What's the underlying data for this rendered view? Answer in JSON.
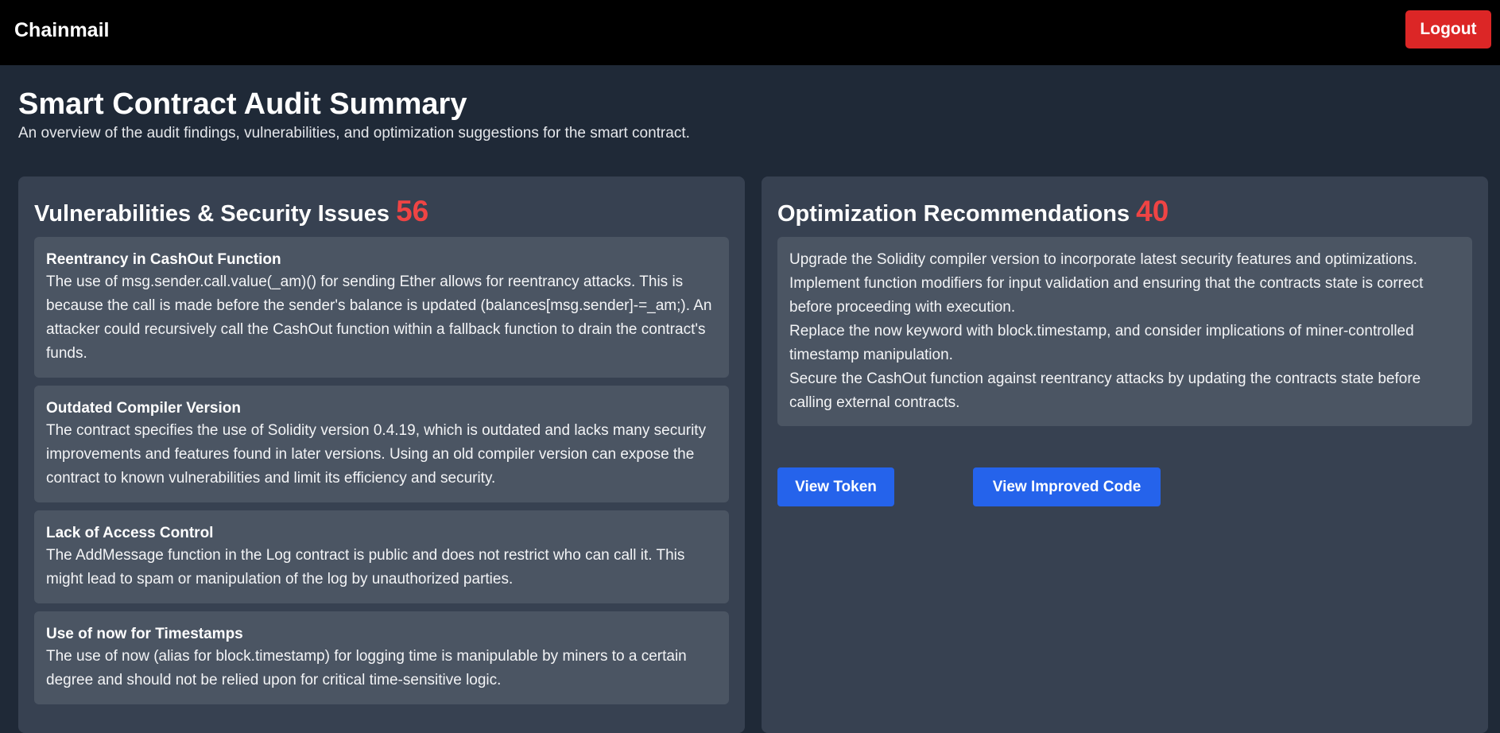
{
  "header": {
    "brand": "Chainmail",
    "logout_label": "Logout"
  },
  "page": {
    "title": "Smart Contract Audit Summary",
    "subtitle": "An overview of the audit findings, vulnerabilities, and optimization suggestions for the smart contract."
  },
  "vulnerabilities": {
    "heading": "Vulnerabilities & Security Issues",
    "count": "56",
    "items": [
      {
        "title": "Reentrancy in CashOut Function",
        "description": "The use of msg.sender.call.value(_am)() for sending Ether allows for reentrancy attacks. This is because the call is made before the sender's balance is updated (balances[msg.sender]-=_am;). An attacker could recursively call the CashOut function within a fallback function to drain the contract's funds."
      },
      {
        "title": "Outdated Compiler Version",
        "description": "The contract specifies the use of Solidity version 0.4.19, which is outdated and lacks many security improvements and features found in later versions. Using an old compiler version can expose the contract to known vulnerabilities and limit its efficiency and security."
      },
      {
        "title": "Lack of Access Control",
        "description": "The AddMessage function in the Log contract is public and does not restrict who can call it. This might lead to spam or manipulation of the log by unauthorized parties."
      },
      {
        "title": "Use of now for Timestamps",
        "description": "The use of now (alias for block.timestamp) for logging time is manipulable by miners to a certain degree and should not be relied upon for critical time-sensitive logic."
      }
    ]
  },
  "optimizations": {
    "heading": "Optimization Recommendations",
    "count": "40",
    "items": [
      "Upgrade the Solidity compiler version to incorporate latest security features and optimizations.",
      "Implement function modifiers for input validation and ensuring that the contracts state is correct before proceeding with execution.",
      "Replace the now keyword with block.timestamp, and consider implications of miner-controlled timestamp manipulation.",
      "Secure the CashOut function against reentrancy attacks by updating the contracts state before calling external contracts."
    ]
  },
  "actions": {
    "view_token_label": "View Token",
    "view_code_label": "View Improved Code"
  }
}
